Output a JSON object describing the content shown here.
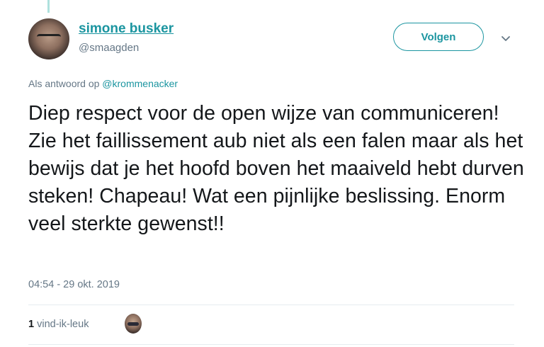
{
  "tweet": {
    "author": {
      "name": "simone busker",
      "handle": "@smaagden"
    },
    "follow_label": "Volgen",
    "reply_prefix": "Als antwoord op",
    "reply_to": "@krommenacker",
    "text": "Diep respect voor de open wijze van communiceren! Zie het faillissement aub niet als een falen maar als het bewijs dat je het hoofd boven het maaiveld hebt durven steken! Chapeau! Wat een pijnlijke beslissing. Enorm veel sterkte gewenst!!",
    "timestamp": "04:54 - 29 okt. 2019",
    "likes": {
      "count": "1",
      "label": "vind-ik-leuk"
    },
    "colors": {
      "accent": "#1b95a0",
      "muted": "#657786",
      "text": "#14171a",
      "thread_line": "#aee1dd"
    },
    "icons": [
      "chevron-down-icon"
    ]
  }
}
